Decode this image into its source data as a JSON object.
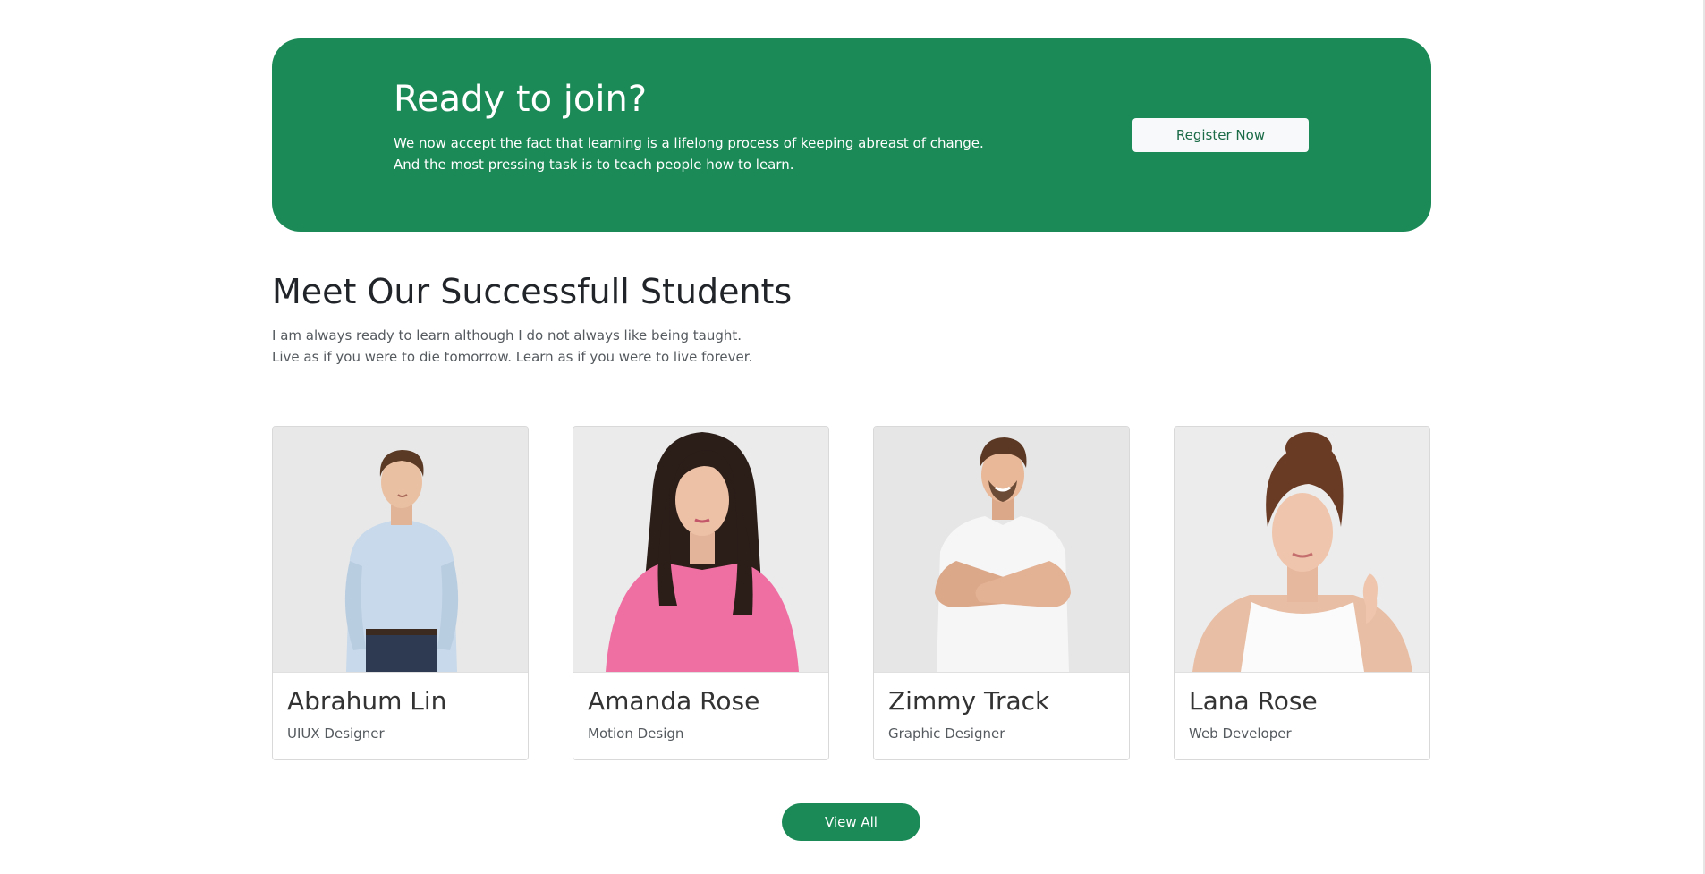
{
  "colors": {
    "brand_green": "#1b8a57",
    "button_light": "#f8f9fa",
    "text_dark": "#212529",
    "text_muted": "#555a5f"
  },
  "cta": {
    "title": "Ready to join?",
    "line1": "We now accept the fact that learning is a lifelong process of keeping abreast of change.",
    "line2": "And the most pressing task is to teach people how to learn.",
    "register_label": "Register Now"
  },
  "students_section": {
    "title": "Meet Our Successfull Students",
    "line1": "I am always ready to learn although I do not always like being taught.",
    "line2": "Live as if you were to die tomorrow. Learn as if you were to live forever.",
    "view_all_label": "View All",
    "students": [
      {
        "name": "Abrahum Lin",
        "role": "UIUX Designer",
        "photo_icon": "man-light-blue-shirt-portrait"
      },
      {
        "name": "Amanda Rose",
        "role": "Motion Design",
        "photo_icon": "woman-pink-sweater-portrait"
      },
      {
        "name": "Zimmy Track",
        "role": "Graphic Designer",
        "photo_icon": "man-white-tshirt-portrait"
      },
      {
        "name": "Lana Rose",
        "role": "Web Developer",
        "photo_icon": "woman-white-top-portrait"
      }
    ]
  }
}
